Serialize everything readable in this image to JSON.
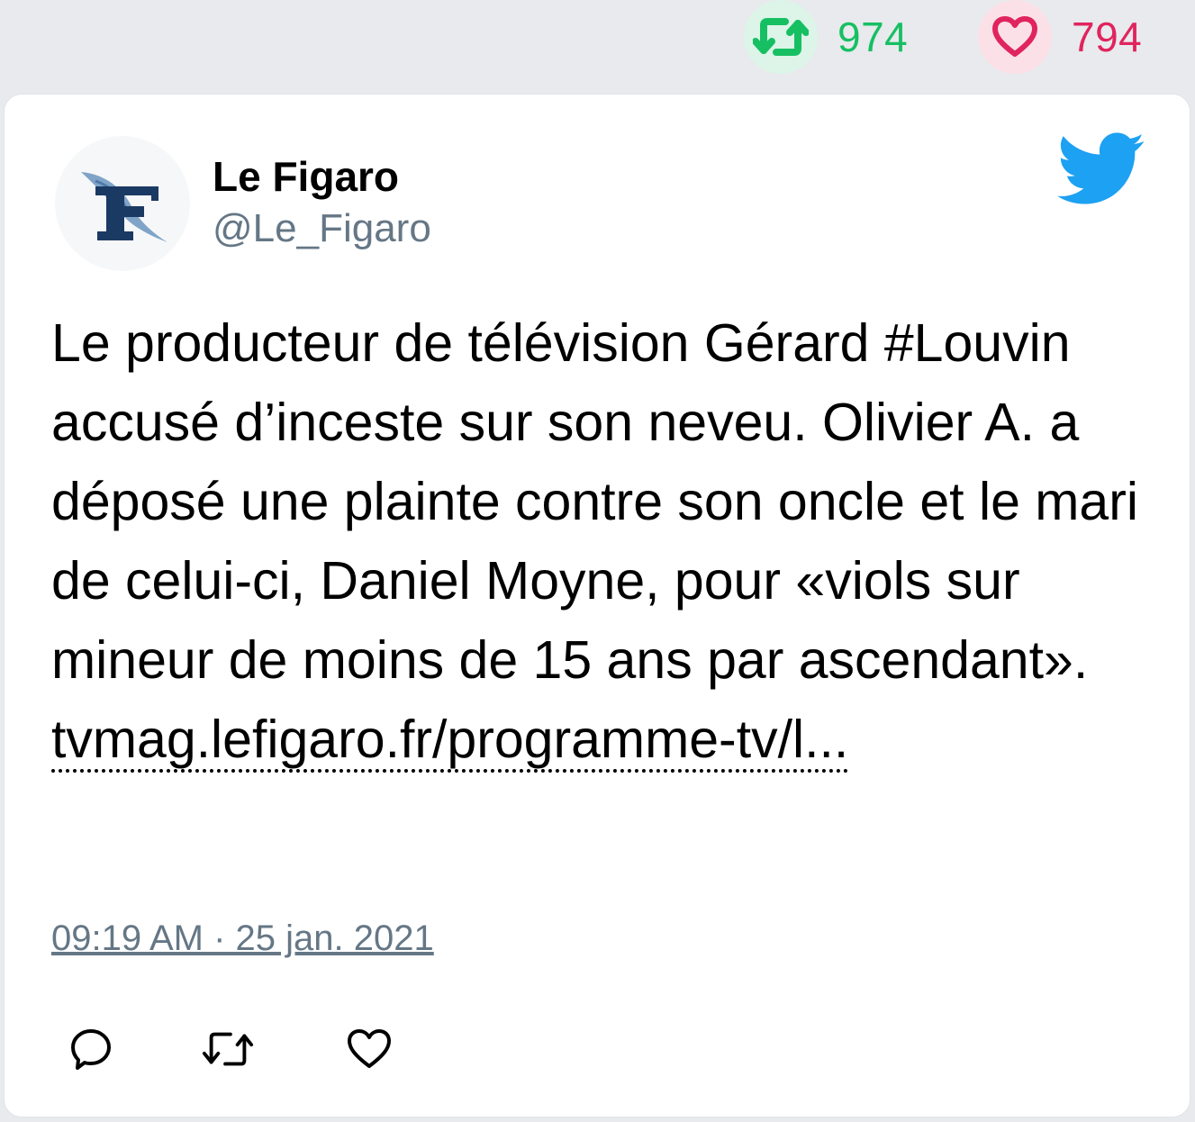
{
  "stats": {
    "retweets": "974",
    "likes": "794"
  },
  "tweet": {
    "display_name": "Le Figaro",
    "handle": "@Le_Figaro",
    "text": "Le producteur de télévision Gérard #Louvin accusé d’inceste sur son neveu. Olivier A. a déposé une plainte contre son oncle et le mari de celui-ci, Daniel Moyne, pour «viols sur mineur de moins de 15 ans par ascendant». ",
    "link": "tvmag.lefigaro.fr/programme-tv/l...",
    "timestamp": "09:19 AM · 25 jan. 2021"
  },
  "colors": {
    "retweet": "#17bf63",
    "like": "#e0245e",
    "twitter_blue": "#1da1f2",
    "secondary_text": "#657786",
    "figaro_navy": "#1b3a63"
  },
  "icons": {
    "retweet": "retweet-icon",
    "like": "heart-icon",
    "reply": "reply-icon",
    "brand": "twitter-bird-icon",
    "avatar": "le-figaro-logo"
  }
}
